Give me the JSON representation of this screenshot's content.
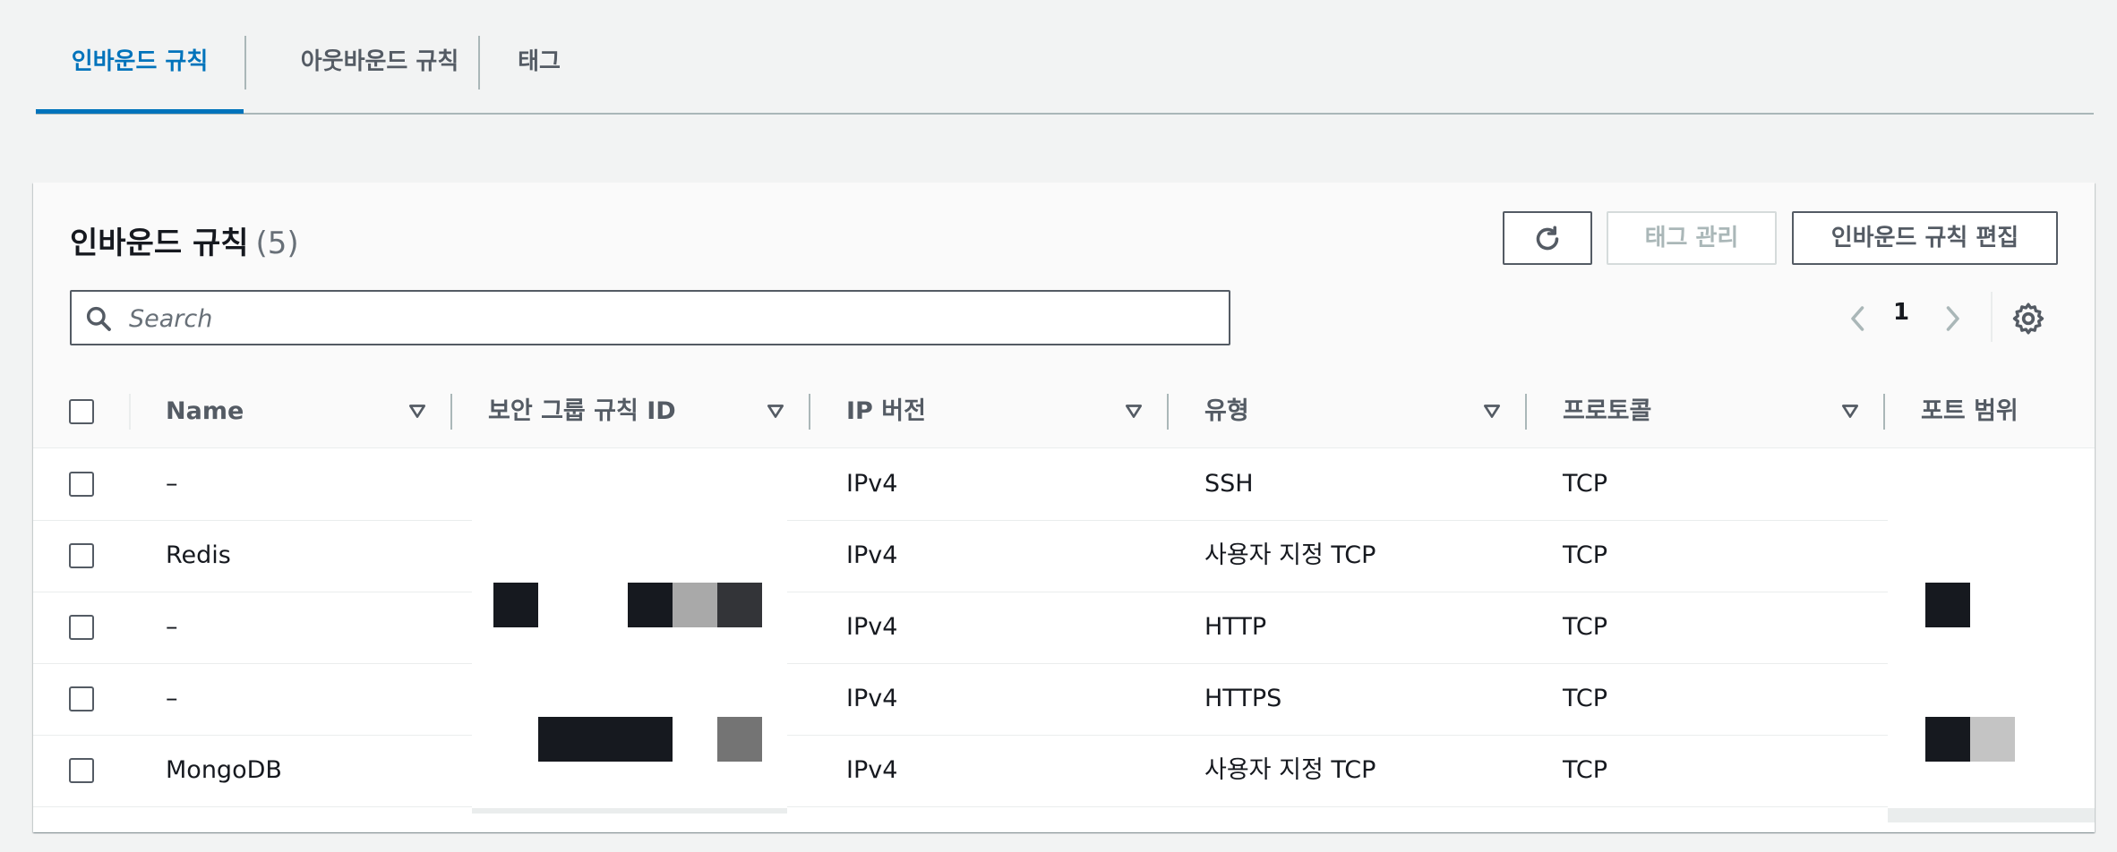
{
  "tabs": [
    {
      "label": "인바운드 규칙",
      "active": true
    },
    {
      "label": "아웃바운드 규칙",
      "active": false
    },
    {
      "label": "태그",
      "active": false
    }
  ],
  "panel": {
    "title": "인바운드 규칙",
    "count": "(5)",
    "buttons": {
      "refresh_icon": "refresh-icon",
      "manage_tags": "태그 관리",
      "edit_inbound": "인바운드 규칙 편집"
    },
    "search": {
      "placeholder": "Search",
      "value": ""
    },
    "pagination": {
      "page": "1"
    }
  },
  "table": {
    "columns": [
      "Name",
      "보안 그룹 규칙 ID",
      "IP 버전",
      "유형",
      "프로토콜",
      "포트 범위"
    ],
    "rows": [
      {
        "name": "–",
        "ip_version": "IPv4",
        "type": "SSH",
        "protocol": "TCP"
      },
      {
        "name": "Redis",
        "ip_version": "IPv4",
        "type": "사용자 지정 TCP",
        "protocol": "TCP"
      },
      {
        "name": "–",
        "ip_version": "IPv4",
        "type": "HTTP",
        "protocol": "TCP"
      },
      {
        "name": "–",
        "ip_version": "IPv4",
        "type": "HTTPS",
        "protocol": "TCP"
      },
      {
        "name": "MongoDB",
        "ip_version": "IPv4",
        "type": "사용자 지정 TCP",
        "protocol": "TCP"
      }
    ]
  },
  "colors": {
    "accent": "#0073bb",
    "text": "#16191f",
    "muted": "#545b64",
    "border": "#aab7b8",
    "background": "#f2f3f3"
  }
}
